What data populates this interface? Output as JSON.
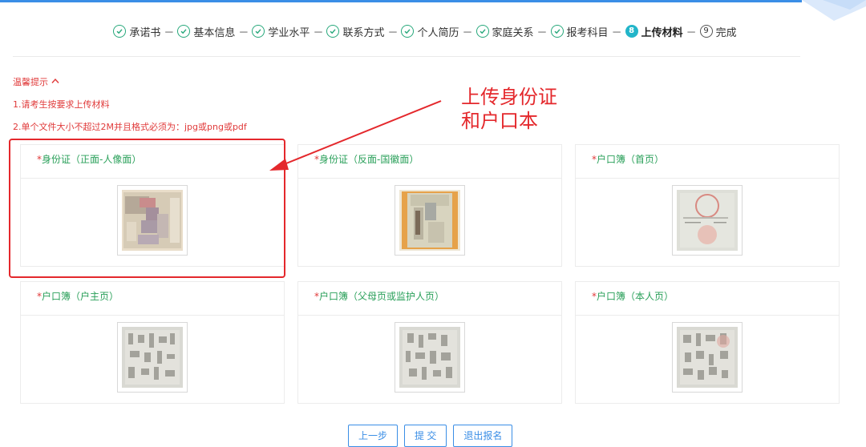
{
  "steps": [
    {
      "label": "承诺书",
      "state": "done"
    },
    {
      "label": "基本信息",
      "state": "done"
    },
    {
      "label": "学业水平",
      "state": "done"
    },
    {
      "label": "联系方式",
      "state": "done"
    },
    {
      "label": "个人简历",
      "state": "done"
    },
    {
      "label": "家庭关系",
      "state": "done"
    },
    {
      "label": "报考科目",
      "state": "done"
    },
    {
      "label": "上传材料",
      "state": "active",
      "number": "8"
    },
    {
      "label": "完成",
      "state": "pending",
      "number": "9"
    }
  ],
  "separator": "－",
  "tips": {
    "title": "温馨提示",
    "line1": "1.请考生按要求上传材料",
    "line2": "2.单个文件大小不超过2M并且格式必须为：jpg或png或pdf"
  },
  "annotation": {
    "line1": "上传身份证",
    "line2": "和户口本"
  },
  "uploads": [
    {
      "required": "*",
      "label": "身份证（正面-人像面）"
    },
    {
      "required": "*",
      "label": "身份证（反面-国徽面）"
    },
    {
      "required": "*",
      "label": "户口簿（首页）"
    },
    {
      "required": "*",
      "label": "户口簿（户主页）"
    },
    {
      "required": "*",
      "label": "户口簿（父母页或监护人页）"
    },
    {
      "required": "*",
      "label": "户口簿（本人页）"
    }
  ],
  "buttons": {
    "prev": "上一步",
    "submit": "提 交",
    "quit": "退出报名"
  },
  "colors": {
    "accent": "#3a8ee6",
    "done": "#27a87b",
    "active": "#22b5c9",
    "warning": "#e03a3a",
    "annotation": "#e4282c"
  }
}
